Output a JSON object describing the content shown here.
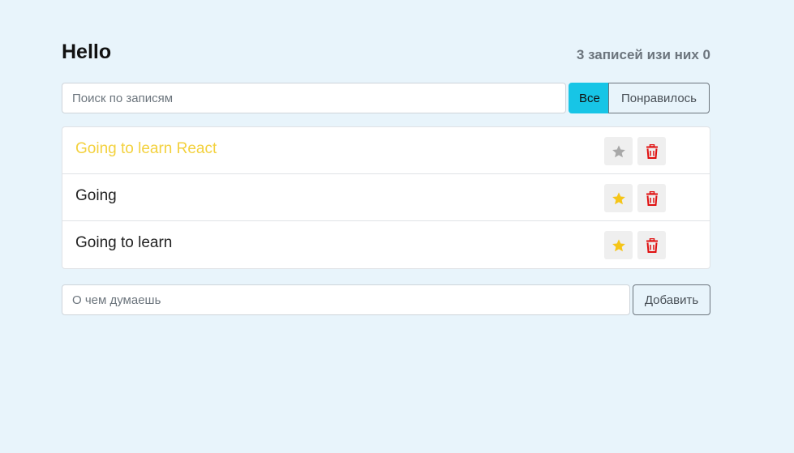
{
  "header": {
    "title": "Hello",
    "counter": "3 записей изи них 0"
  },
  "search": {
    "placeholder": "Поиск по записям",
    "value": ""
  },
  "filters": {
    "all_label": "Все",
    "liked_label": "Понравилось",
    "active": "all",
    "active_color": "#17c5e6"
  },
  "posts": [
    {
      "label": "Going to learn React",
      "important": true,
      "star_icon": "star-icon",
      "delete_icon": "trash-icon"
    },
    {
      "label": "Going",
      "important": false,
      "star_icon": "star-icon",
      "delete_icon": "trash-icon"
    },
    {
      "label": "Going to learn",
      "important": false,
      "star_icon": "star-icon",
      "delete_icon": "trash-icon"
    }
  ],
  "add_form": {
    "placeholder": "О чем думаешь",
    "value": "",
    "button_label": "Добавить"
  },
  "colors": {
    "background": "#e8f4fb",
    "important_text": "#f3d13d",
    "star_active": "#f5c518",
    "star_inactive": "#a8a8a8",
    "trash": "#e01010"
  }
}
